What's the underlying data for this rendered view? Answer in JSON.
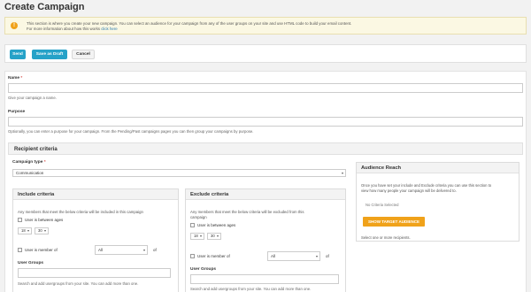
{
  "page": {
    "title": "Create Campaign"
  },
  "notice": {
    "icon": "warning-icon",
    "line1": "This section is where you create your new campaign. You can select an audience for your campaign from any of the user groups on your site and use HTML code to build your email content.",
    "line2_prefix": "For more information about how this works ",
    "line2_link": "click here"
  },
  "actions": {
    "send": "Send",
    "save_draft": "Save as Draft",
    "cancel": "Cancel"
  },
  "form": {
    "name_label": "Name",
    "name_required": "*",
    "name_help": "Give your campaign a name.",
    "purpose_label": "Purpose",
    "purpose_help": "Optionally, you can enter a purpose for your campaign. From the Pending/Past campaigns pages you can then group your campaigns by purpose."
  },
  "recipient": {
    "header": "Recipient criteria",
    "campaign_type_label": "Campaign type",
    "campaign_type_required": "*",
    "campaign_type_value": "Communication"
  },
  "include": {
    "header": "Include criteria",
    "desc": "Any members that meet the below criteria will be included in this campaign",
    "ages_label": "User is between ages",
    "age_from": "18",
    "age_to": "30",
    "member_label": "User is member of",
    "member_value": "All",
    "of_label": "of",
    "groups_label": "User Groups",
    "groups_help": "Search and add usergroups from your site. You can add more than one."
  },
  "exclude": {
    "header": "Exclude criteria",
    "desc_line1": "Any members that meet the below criteria will be excluded from this",
    "desc_line2": "campaign",
    "ages_label": "User is between ages",
    "age_from": "18",
    "age_to": "30",
    "member_label": "User is member of",
    "member_value": "All",
    "of_label": "of",
    "groups_label": "User Groups",
    "groups_help": "Search and add usergroups from your site. You can add more than one."
  },
  "audience": {
    "header": "Audience Reach",
    "desc_line1": "Once you have set your include and Exclude criteria you can use this section to",
    "desc_line2": "view how many people your campaign will be delivered to.",
    "no_criteria": "No Criteria Selected",
    "show_button": "SHOW TARGET AUDIENCE",
    "footer": "Select one or more recipients."
  },
  "colors": {
    "primary": "#26a2c8",
    "accent": "#f0a21a",
    "required": "#d9534f"
  }
}
